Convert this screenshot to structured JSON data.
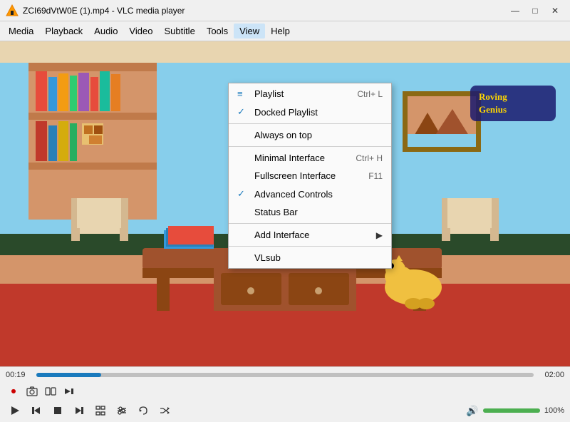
{
  "window": {
    "title": "ZCI69dVtW0E (1).mp4 - VLC media player",
    "controls": {
      "minimize": "—",
      "maximize": "□",
      "close": "✕"
    }
  },
  "menubar": {
    "items": [
      "Media",
      "Playback",
      "Audio",
      "Video",
      "Subtitle",
      "Tools",
      "View",
      "Help"
    ]
  },
  "view_menu": {
    "items": [
      {
        "id": "playlist",
        "label": "Playlist",
        "shortcut": "Ctrl+ L",
        "checked": false,
        "has_arrow": false,
        "separator_after": false
      },
      {
        "id": "docked_playlist",
        "label": "Docked Playlist",
        "shortcut": "",
        "checked": true,
        "has_arrow": false,
        "separator_after": false
      },
      {
        "id": "separator1",
        "label": "",
        "separator": true
      },
      {
        "id": "always_on_top",
        "label": "Always on top",
        "shortcut": "",
        "checked": false,
        "has_arrow": false,
        "separator_after": false
      },
      {
        "id": "separator2",
        "label": "",
        "separator": true
      },
      {
        "id": "minimal_interface",
        "label": "Minimal Interface",
        "shortcut": "Ctrl+ H",
        "checked": false,
        "has_arrow": false,
        "separator_after": false
      },
      {
        "id": "fullscreen_interface",
        "label": "Fullscreen Interface",
        "shortcut": "F11",
        "checked": false,
        "has_arrow": false,
        "separator_after": false
      },
      {
        "id": "advanced_controls",
        "label": "Advanced Controls",
        "shortcut": "",
        "checked": true,
        "has_arrow": false,
        "separator_after": false
      },
      {
        "id": "status_bar",
        "label": "Status Bar",
        "shortcut": "",
        "checked": false,
        "has_arrow": false,
        "separator_after": false
      },
      {
        "id": "separator3",
        "label": "",
        "separator": true
      },
      {
        "id": "add_interface",
        "label": "Add Interface",
        "shortcut": "",
        "checked": false,
        "has_arrow": true,
        "separator_after": false
      },
      {
        "id": "separator4",
        "label": "",
        "separator": true
      },
      {
        "id": "vlsub",
        "label": "VLsub",
        "shortcut": "",
        "checked": false,
        "has_arrow": false,
        "separator_after": false
      }
    ]
  },
  "player": {
    "time_current": "00:19",
    "time_total": "02:00",
    "progress_pct": 13,
    "volume_pct": 100,
    "volume_label": "100%"
  },
  "advanced_controls": {
    "buttons": [
      "●",
      "📷",
      "🎞",
      "⏭"
    ]
  },
  "main_controls": {
    "buttons": [
      "▶",
      "⏮",
      "■",
      "⏭",
      "⛶",
      "≣",
      "⇄",
      "✖"
    ],
    "labels": [
      "play",
      "prev",
      "stop",
      "next",
      "fullscreen",
      "extended",
      "loop",
      "random"
    ]
  }
}
